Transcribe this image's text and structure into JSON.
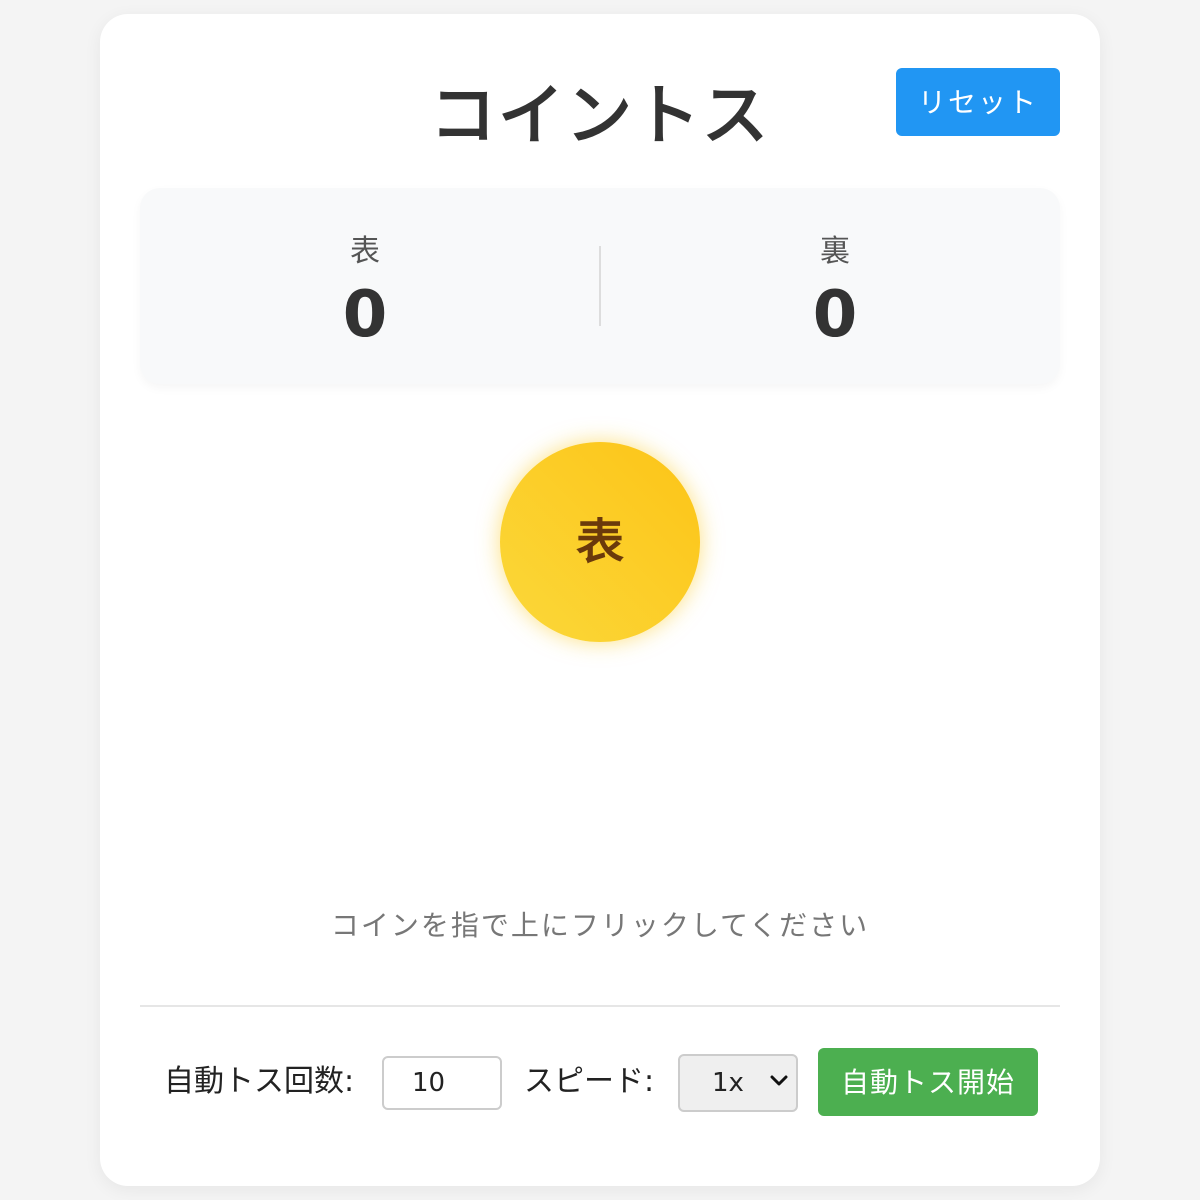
{
  "header": {
    "title": "コイントス",
    "reset_label": "リセット"
  },
  "scores": {
    "heads_label": "表",
    "heads_value": "0",
    "tails_label": "裏",
    "tails_value": "0"
  },
  "coin": {
    "face": "表"
  },
  "hint": "コインを指で上にフリックしてください",
  "controls": {
    "count_label": "自動トス回数:",
    "count_value": "10",
    "speed_label": "スピード:",
    "speed_value": "1x",
    "start_label": "自動トス開始"
  },
  "colors": {
    "reset_button": "#2196f3",
    "start_button": "#4caf50",
    "coin": "#fcc417"
  },
  "icons": {
    "select_arrow": "chevron-down-icon"
  }
}
